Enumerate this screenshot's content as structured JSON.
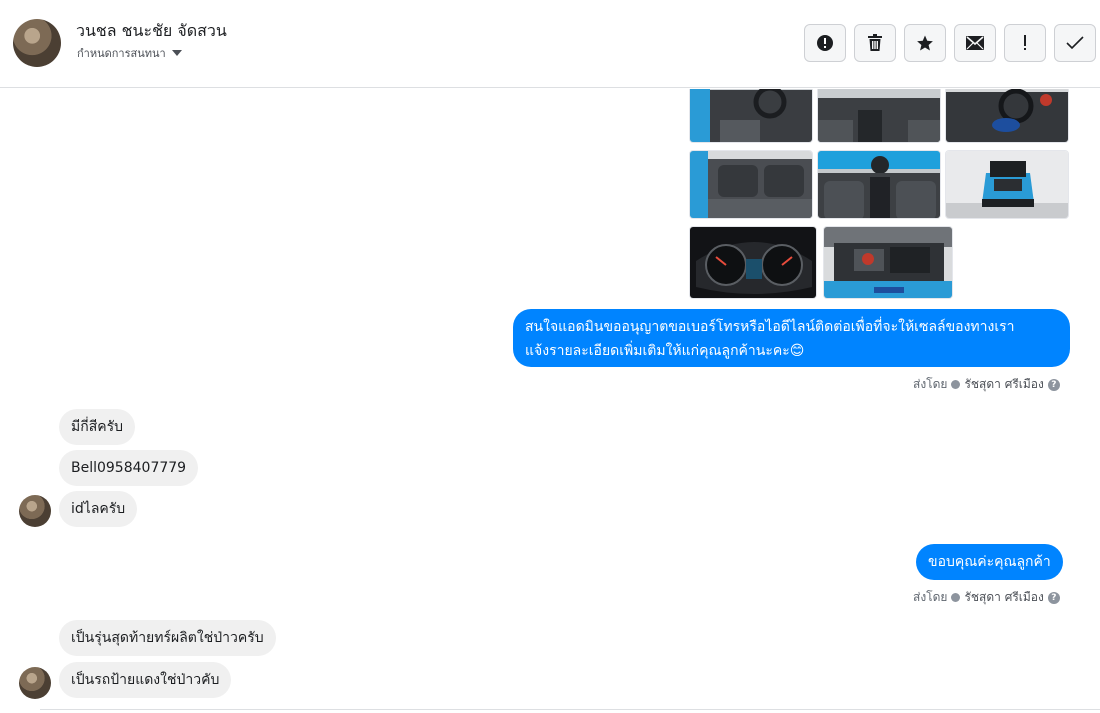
{
  "header": {
    "contact_name": "วนชล ชนะชัย จัดสวน",
    "status_label": "กำหนดการสนทนา"
  },
  "actions": [
    {
      "name": "report-button",
      "icon": "alert-circle-icon"
    },
    {
      "name": "delete-button",
      "icon": "trash-icon"
    },
    {
      "name": "star-button",
      "icon": "star-icon"
    },
    {
      "name": "mark-unread-button",
      "icon": "envelope-icon"
    },
    {
      "name": "important-button",
      "icon": "exclamation-icon"
    },
    {
      "name": "done-button",
      "icon": "check-icon"
    }
  ],
  "messages": {
    "out1": "สนใจแอดมินขออนุญาตขอเบอร์โทรหรือไอดีไลน์ติดต่อเพื่อที่จะให้เซลล์ของทางเรา",
    "out1b": "แจ้งรายละเอียดเพิ่มเติมให้แก่คุณลูกค้านะคะ😊",
    "sent_by_1": "ส่งโดย",
    "agent_1": "รัชสุดา ศรีเมือง",
    "in1": "มีกี่สีครับ",
    "in2": "Bell0958407779",
    "in3": "idไลครับ",
    "out2": "ขอบคุณค่ะคุณลูกค้า",
    "sent_by_2": "ส่งโดย",
    "agent_2": "รัชสุดา ศรีเมือง",
    "in4": "เป็นรุ่นสุดท้ายทร์ผลิตใช่ป่าวครับ",
    "in5": "เป็นรถป้ายแดงใช่ป่าวคับ"
  },
  "colors": {
    "accent": "#0084ff",
    "incoming_bubble": "#f0f0f0"
  }
}
